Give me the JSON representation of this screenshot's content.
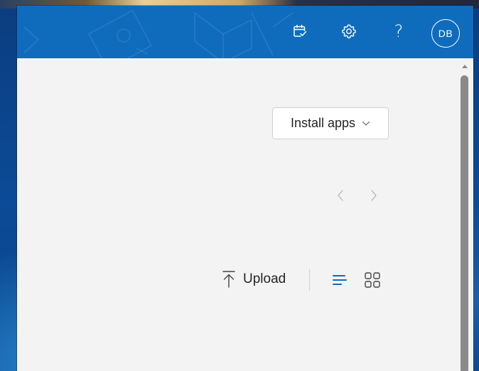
{
  "header": {
    "icons": {
      "my_day": "calendar-check-icon",
      "settings": "gear-icon",
      "help": "question-mark-icon"
    },
    "help_label": "?",
    "avatar_initials": "DB"
  },
  "toolbar": {
    "install_apps_label": "Install apps",
    "upload_label": "Upload"
  },
  "colors": {
    "header_bg": "#0f6cbd",
    "accent": "#0f6cbd",
    "content_bg": "#f3f3f3"
  }
}
